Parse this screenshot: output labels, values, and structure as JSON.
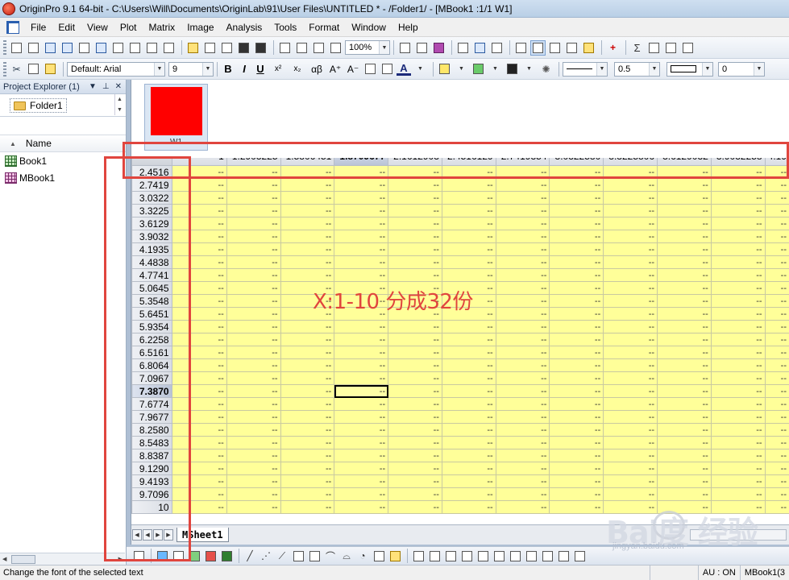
{
  "window": {
    "title": "OriginPro 9.1 64-bit - C:\\Users\\Will\\Documents\\OriginLab\\91\\User Files\\UNTITLED * - /Folder1/ - [MBook1 :1/1 W1]"
  },
  "menu": [
    "File",
    "Edit",
    "View",
    "Plot",
    "Matrix",
    "Image",
    "Analysis",
    "Tools",
    "Format",
    "Window",
    "Help"
  ],
  "toolbar1": {
    "zoom_value": "100%"
  },
  "toolbar2": {
    "font_name": "Default: Arial",
    "font_size": "9",
    "bold": "B",
    "italic": "I",
    "underline": "U",
    "superscript": "x²",
    "subscript": "x₂",
    "greek": "αβ",
    "larger_font": "A⁺",
    "smaller_font": "A⁻",
    "line_width": "0.5",
    "rotation": "0"
  },
  "project_explorer": {
    "title": "Project Explorer (1)",
    "folder": "Folder1",
    "name_column": "Name",
    "items": [
      {
        "label": "Book1",
        "type": "workbook"
      },
      {
        "label": "MBook1",
        "type": "matrixbook"
      }
    ]
  },
  "matrix": {
    "thumbnail_label": "W1",
    "column_headers": [
      "1",
      "1.2903225",
      "1.5806451",
      "1.8709677",
      "2.1612903",
      "2.4516129",
      "2.7419354",
      "3.0322580",
      "3.3225806",
      "3.6129032",
      "3.9032258",
      "4.19"
    ],
    "selected_column_index": 3,
    "row_labels": [
      "2.4516",
      "2.7419",
      "3.0322",
      "3.3225",
      "3.6129",
      "3.9032",
      "4.1935",
      "4.4838",
      "4.7741",
      "5.0645",
      "5.3548",
      "5.6451",
      "5.9354",
      "6.2258",
      "6.5161",
      "6.8064",
      "7.0967",
      "7.3870",
      "7.6774",
      "7.9677",
      "8.2580",
      "8.5483",
      "8.8387",
      "9.1290",
      "9.4193",
      "9.7096",
      "10"
    ],
    "selected_row_index": 17,
    "empty_cell_text": "--",
    "sheet_tab": "MSheet1"
  },
  "annotation": {
    "text": "X:1-10 分成32份",
    "color": "#e0453e"
  },
  "statusbar": {
    "message": "Change the font of the selected text",
    "au": "AU : ON",
    "book": "MBook1(3"
  },
  "watermark": {
    "brand": "Bai度 经验",
    "sub": "jingyan.baidu.com"
  },
  "colors": {
    "cell_fill": "#ffff99",
    "thumbnail_fill": "#ff0000",
    "annotation": "#e0453e"
  }
}
